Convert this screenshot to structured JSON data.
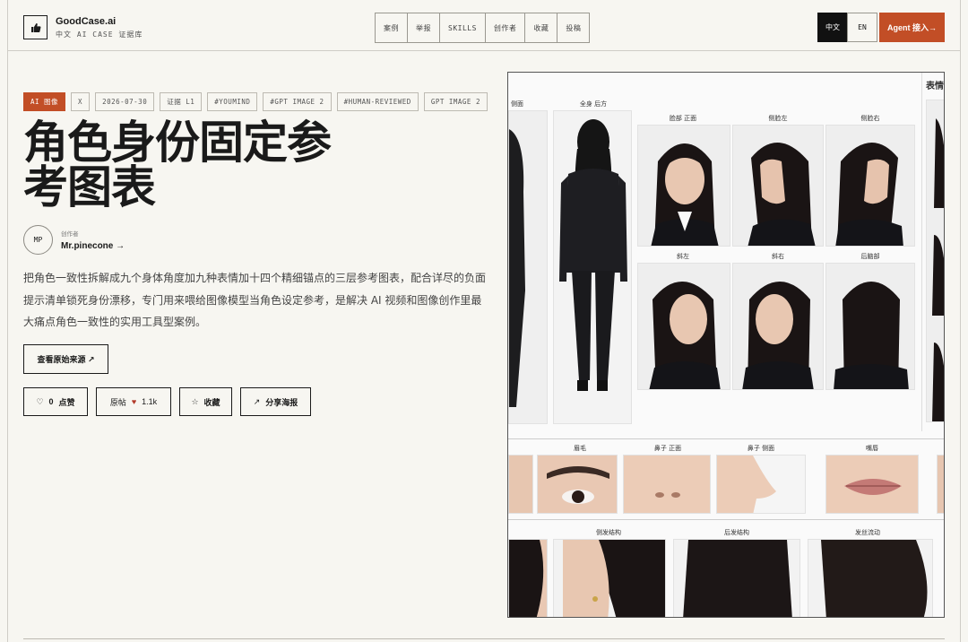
{
  "brand": {
    "name": "GoodCase.ai",
    "subtitle": "中文 AI CASE 证据库"
  },
  "nav": [
    "案例",
    "举报",
    "SKILLS",
    "创作者",
    "收藏",
    "投稿"
  ],
  "lang": {
    "zh": "中文",
    "en": "EN"
  },
  "agent_button": "Agent 接入→",
  "tags": [
    "AI 图像",
    "X",
    "2026-07-30",
    "证据 L1",
    "#YOUMIND",
    "#GPT IMAGE 2",
    "#HUMAN-REVIEWED",
    "GPT IMAGE 2"
  ],
  "title": "角色身份固定参考图表",
  "author": {
    "initials": "MP",
    "label": "创作者",
    "name": "Mr.pinecone →"
  },
  "description": "把角色一致性拆解成九个身体角度加九种表情加十四个精细锚点的三层参考图表，配合详尽的负面提示清单锁死身份漂移，专门用来喂给图像模型当角色设定参考，是解决 AI 视频和图像创作里最大痛点角色一致性的实用工具型案例。",
  "source_button": "查看原始来源 ↗",
  "actions": {
    "like_count": "0",
    "like_label": "点赞",
    "post_label": "原帖",
    "post_count": "1.1k",
    "fav_label": "收藏",
    "share_label": "分享海报"
  },
  "sheet_labels": {
    "side": "侧面",
    "full_back": "全身 后方",
    "face_front": "脸部 正面",
    "face_left": "侧脸左",
    "face_right": "侧脸右",
    "expr": "表情",
    "tilt_left": "斜左",
    "tilt_right": "斜右",
    "back_head": "后脑部",
    "brow": "眉毛",
    "nose_front": "鼻子 正面",
    "nose_side": "鼻子 侧面",
    "lips": "嘴唇",
    "side_hair": "侧发结构",
    "back_hair": "后发结构",
    "hair_flow": "发丝流动"
  },
  "colors": {
    "accent": "#c24e26",
    "background": "#f7f6f1",
    "border": "#cfcdc6"
  },
  "icons": [
    "thumbs-up-icon",
    "heart-outline-icon",
    "heart-filled-icon",
    "star-icon",
    "arrow-up-right-icon"
  ]
}
